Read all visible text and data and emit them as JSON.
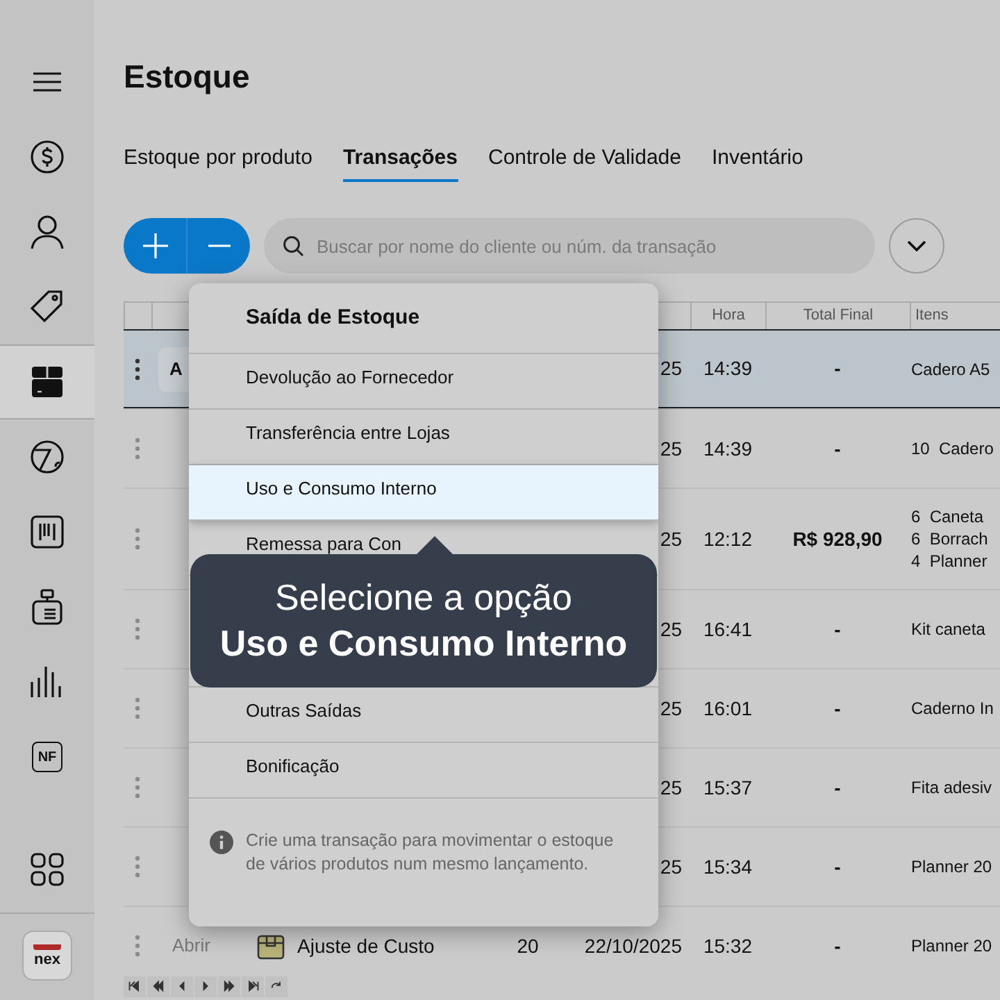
{
  "sidebar": {
    "items": [
      {
        "kind": "menu",
        "selected": false
      },
      {
        "kind": "dollar",
        "selected": false
      },
      {
        "kind": "user",
        "selected": false
      },
      {
        "kind": "tag",
        "selected": false
      },
      {
        "kind": "box",
        "selected": true
      },
      {
        "kind": "pie",
        "selected": false
      },
      {
        "kind": "barcode",
        "selected": false
      },
      {
        "kind": "register",
        "selected": false
      },
      {
        "kind": "bars",
        "selected": false
      },
      {
        "kind": "nf",
        "label": "NF",
        "selected": false
      }
    ],
    "bottom": [
      {
        "kind": "grid",
        "selected": false
      }
    ],
    "logo": "nex"
  },
  "page": {
    "title": "Estoque"
  },
  "tabs": [
    {
      "label": "Estoque por produto",
      "selected": false
    },
    {
      "label": "Transações",
      "selected": true
    },
    {
      "label": "Controle de Validade",
      "selected": false
    },
    {
      "label": "Inventário",
      "selected": false
    }
  ],
  "search": {
    "placeholder": "Buscar por nome do cliente ou núm. da transação"
  },
  "table": {
    "columns": [
      "",
      "",
      "",
      "",
      "",
      "Hora",
      "Total Final",
      "Itens"
    ],
    "rows": [
      {
        "selected": true,
        "action": "A",
        "date": "25",
        "time": "14:39",
        "total": "-",
        "items": [
          "Cadero A5"
        ]
      },
      {
        "selected": false,
        "date": "25",
        "time": "14:39",
        "total": "-",
        "items": [
          "10  Cadero"
        ]
      },
      {
        "selected": false,
        "date": "25",
        "time": "12:12",
        "total": "R$ 928,90",
        "items": [
          "6  Caneta",
          "6  Borrach",
          "4  Planner"
        ]
      },
      {
        "selected": false,
        "date": "25",
        "time": "16:41",
        "total": "-",
        "items": [
          "Kit caneta"
        ]
      },
      {
        "selected": false,
        "date": "25",
        "time": "16:01",
        "total": "-",
        "items": [
          "Caderno In"
        ]
      },
      {
        "selected": false,
        "date": "25",
        "time": "15:37",
        "total": "-",
        "items": [
          "Fita adesiv"
        ]
      },
      {
        "selected": false,
        "date": "25",
        "time": "15:34",
        "total": "-",
        "items": [
          "Planner 20"
        ]
      },
      {
        "selected": false,
        "action": "Abrir",
        "type": "Ajuste de Custo",
        "number": "20",
        "date": "22/10/2025",
        "time": "15:32",
        "total": "-",
        "items": [
          "Planner 20"
        ]
      }
    ]
  },
  "menu": {
    "title": "Saída de Estoque",
    "items": [
      {
        "label": "Devolução ao Fornecedor",
        "selected": false
      },
      {
        "label": "Transferência entre Lojas",
        "selected": false
      },
      {
        "label": "Uso e Consumo Interno",
        "selected": true
      },
      {
        "label": "Remessa para Con",
        "selected": false
      }
    ],
    "after_items": [
      {
        "label": "Outras Saídas",
        "selected": false
      },
      {
        "label": "Bonificação",
        "selected": false
      }
    ],
    "note": "Crie uma transação para movimentar o estoque de vários produtos num mesmo lançamento."
  },
  "tooltip": {
    "line_1": "Selecione a opção",
    "line_2": "Uso e Consumo Interno"
  }
}
